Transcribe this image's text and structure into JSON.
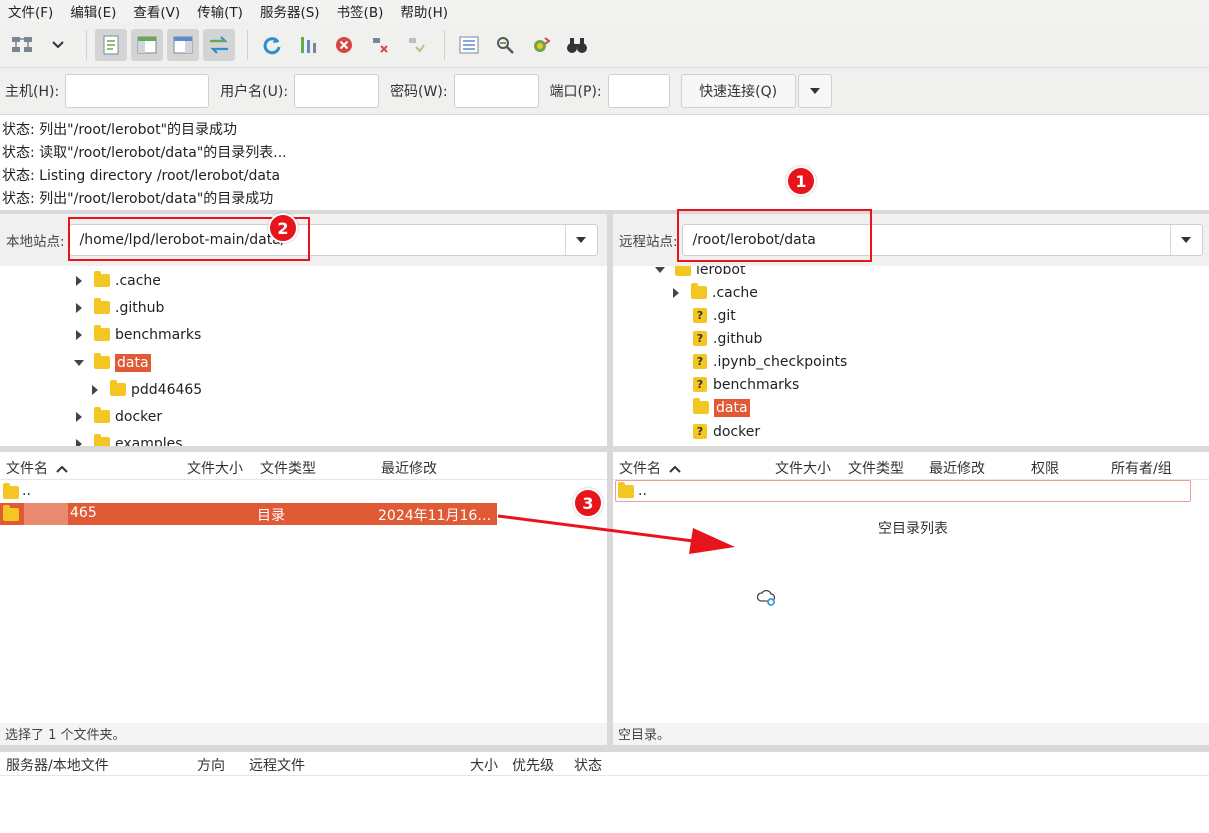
{
  "menu": [
    "文件(F)",
    "编辑(E)",
    "查看(V)",
    "传输(T)",
    "服务器(S)",
    "书签(B)",
    "帮助(H)"
  ],
  "quickconnect": {
    "host_label": "主机(H):",
    "user_label": "用户名(U):",
    "pass_label": "密码(W):",
    "port_label": "端口(P):",
    "connect_button": "快速连接(Q)"
  },
  "log": [
    "状态:  列出\"/root/lerobot\"的目录成功",
    "状态:  读取\"/root/lerobot/data\"的目录列表...",
    "状态:  Listing directory /root/lerobot/data",
    "状态:  列出\"/root/lerobot/data\"的目录成功"
  ],
  "local": {
    "site_label": "本地站点:",
    "path": "/home/lpd/lerobot-main/data/",
    "tree": [
      ".cache",
      ".github",
      "benchmarks",
      "data",
      "pdd46465",
      "docker",
      "examples"
    ],
    "columns": {
      "name": "文件名",
      "size": "文件大小",
      "type": "文件类型",
      "modified": "最近修改"
    },
    "rows": [
      {
        "name": "..",
        "type": "",
        "modified": ""
      },
      {
        "name": "465",
        "type": "目录",
        "modified": "2024年11月16…"
      }
    ],
    "status": "选择了 1 个文件夹。"
  },
  "remote": {
    "site_label": "远程站点:",
    "path": "/root/lerobot/data",
    "tree": [
      "lerobot",
      ".cache",
      ".git",
      ".github",
      ".ipynb_checkpoints",
      "benchmarks",
      "data",
      "docker"
    ],
    "columns": {
      "name": "文件名",
      "size": "文件大小",
      "type": "文件类型",
      "modified": "最近修改",
      "perm": "权限",
      "owner": "所有者/组"
    },
    "rows": [
      {
        "name": ".."
      }
    ],
    "empty_text": "空目录列表",
    "status": "空目录。"
  },
  "queue": {
    "columns": [
      "服务器/本地文件",
      "方向",
      "远程文件",
      "大小",
      "优先级",
      "状态"
    ]
  },
  "annotations": [
    "1",
    "2",
    "3"
  ],
  "colors": {
    "selection": "#e05a36",
    "annotation": "#e8141b",
    "folder": "#f3c623"
  }
}
